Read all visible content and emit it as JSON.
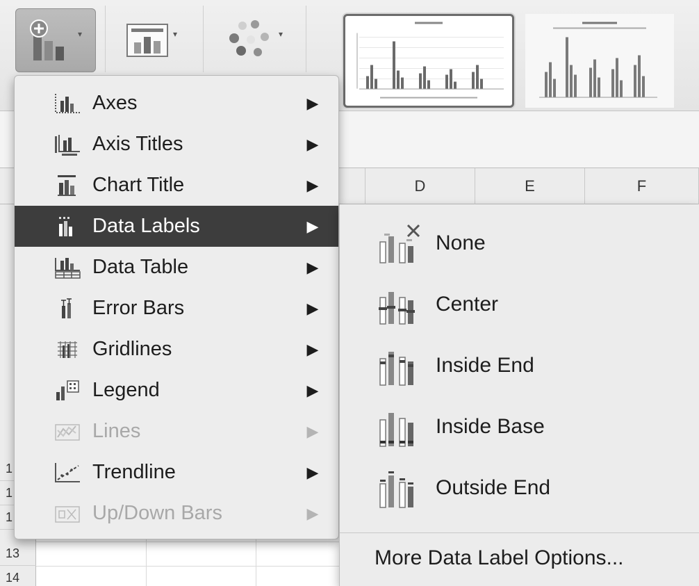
{
  "spreadsheet": {
    "columns": [
      "D",
      "E",
      "F"
    ],
    "rows": [
      "13",
      "14"
    ],
    "partial_row_markers": [
      "1",
      "1",
      "1"
    ]
  },
  "menu": {
    "items": [
      {
        "label": "Axes",
        "icon": "axes-icon",
        "enabled": true,
        "highlighted": false
      },
      {
        "label": "Axis Titles",
        "icon": "axis-titles-icon",
        "enabled": true,
        "highlighted": false
      },
      {
        "label": "Chart Title",
        "icon": "chart-title-icon",
        "enabled": true,
        "highlighted": false
      },
      {
        "label": "Data Labels",
        "icon": "data-labels-icon",
        "enabled": true,
        "highlighted": true
      },
      {
        "label": "Data Table",
        "icon": "data-table-icon",
        "enabled": true,
        "highlighted": false
      },
      {
        "label": "Error Bars",
        "icon": "error-bars-icon",
        "enabled": true,
        "highlighted": false
      },
      {
        "label": "Gridlines",
        "icon": "gridlines-icon",
        "enabled": true,
        "highlighted": false
      },
      {
        "label": "Legend",
        "icon": "legend-icon",
        "enabled": true,
        "highlighted": false
      },
      {
        "label": "Lines",
        "icon": "lines-icon",
        "enabled": false,
        "highlighted": false
      },
      {
        "label": "Trendline",
        "icon": "trendline-icon",
        "enabled": true,
        "highlighted": false
      },
      {
        "label": "Up/Down Bars",
        "icon": "up-down-bars-icon",
        "enabled": false,
        "highlighted": false
      }
    ],
    "submenu_arrow": "▶"
  },
  "submenu": {
    "items": [
      {
        "label": "None",
        "icon": "data-label-none-icon"
      },
      {
        "label": "Center",
        "icon": "data-label-center-icon"
      },
      {
        "label": "Inside End",
        "icon": "data-label-inside-end-icon"
      },
      {
        "label": "Inside Base",
        "icon": "data-label-inside-base-icon"
      },
      {
        "label": "Outside End",
        "icon": "data-label-outside-end-icon"
      }
    ],
    "more": "More Data Label Options..."
  },
  "ribbon": {
    "tools": [
      {
        "name": "add-chart-element",
        "icon": "add-chart-element-icon",
        "pressed": true
      },
      {
        "name": "quick-layout",
        "icon": "quick-layout-icon",
        "pressed": false
      },
      {
        "name": "change-colors",
        "icon": "change-colors-icon",
        "pressed": false
      }
    ],
    "dropdown_arrow": "▾"
  },
  "colors": {
    "highlight": "#3d3d3d",
    "menu_bg": "#ededed",
    "disabled_text": "#a8a8a8"
  }
}
